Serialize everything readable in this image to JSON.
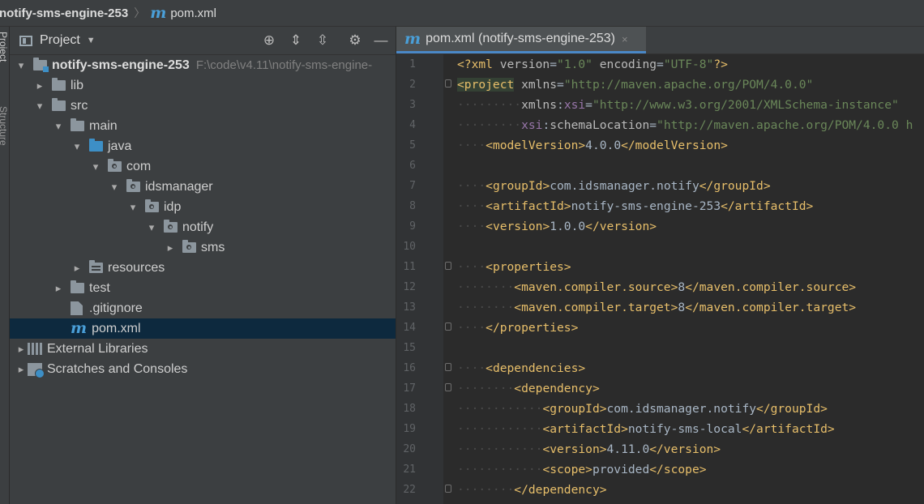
{
  "breadcrumb": {
    "project": "notify-sms-engine-253",
    "file": "pom.xml",
    "file_icon": "m"
  },
  "side_stripe": {
    "project_label": "Project",
    "structure_label": "Structure"
  },
  "project_panel": {
    "title": "Project",
    "tree": [
      {
        "label": "notify-sms-engine-253",
        "path": "F:\\code\\v4.11\\notify-sms-engine-",
        "depth": 0,
        "arrow": "down",
        "icon": "module-folder",
        "bold": true
      },
      {
        "label": "lib",
        "depth": 1,
        "arrow": "right",
        "icon": "folder"
      },
      {
        "label": "src",
        "depth": 1,
        "arrow": "down",
        "icon": "folder"
      },
      {
        "label": "main",
        "depth": 2,
        "arrow": "down",
        "icon": "folder"
      },
      {
        "label": "java",
        "depth": 3,
        "arrow": "down",
        "icon": "source-folder"
      },
      {
        "label": "com",
        "depth": 4,
        "arrow": "down",
        "icon": "package"
      },
      {
        "label": "idsmanager",
        "depth": 5,
        "arrow": "down",
        "icon": "package"
      },
      {
        "label": "idp",
        "depth": 6,
        "arrow": "down",
        "icon": "package"
      },
      {
        "label": "notify",
        "depth": 7,
        "arrow": "down",
        "icon": "package"
      },
      {
        "label": "sms",
        "depth": 8,
        "arrow": "right",
        "icon": "package"
      },
      {
        "label": "resources",
        "depth": 3,
        "arrow": "right",
        "icon": "resources-folder"
      },
      {
        "label": "test",
        "depth": 2,
        "arrow": "right",
        "icon": "folder"
      },
      {
        "label": ".gitignore",
        "depth": 2,
        "arrow": "none",
        "icon": "gitignore"
      },
      {
        "label": "pom.xml",
        "depth": 2,
        "arrow": "none",
        "icon": "maven",
        "selected": true
      },
      {
        "label": "External Libraries",
        "depth": 0,
        "arrow": "right",
        "icon": "libraries"
      },
      {
        "label": "Scratches and Consoles",
        "depth": 0,
        "arrow": "right",
        "icon": "scratches"
      }
    ]
  },
  "editor": {
    "tab_label": "pom.xml (notify-sms-engine-253)",
    "tab_close": "×",
    "lines": [
      {
        "n": "1",
        "indent": 0,
        "parts": [
          [
            "tag",
            "<?xml "
          ],
          [
            "attr",
            "version"
          ],
          [
            "pl",
            "="
          ],
          [
            "val",
            "\"1.0\""
          ],
          [
            "attr",
            " encoding"
          ],
          [
            "pl",
            "="
          ],
          [
            "val",
            "\"UTF-8\""
          ],
          [
            "tag",
            "?>"
          ]
        ]
      },
      {
        "n": "2",
        "indent": 0,
        "fold": true,
        "parts": [
          [
            "hl",
            "<project"
          ],
          [
            "attr",
            " xmlns"
          ],
          [
            "pl",
            "="
          ],
          [
            "val",
            "\"http://maven.apache.org/POM/4.0.0\""
          ]
        ]
      },
      {
        "n": "3",
        "indent": 9,
        "parts": [
          [
            "attr",
            "xmlns"
          ],
          [
            "pl",
            ":"
          ],
          [
            "ns",
            "xsi"
          ],
          [
            "pl",
            "="
          ],
          [
            "val",
            "\"http://www.w3.org/2001/XMLSchema-instance\""
          ]
        ]
      },
      {
        "n": "4",
        "indent": 9,
        "parts": [
          [
            "ns",
            "xsi"
          ],
          [
            "pl",
            ":"
          ],
          [
            "attr",
            "schemaLocation"
          ],
          [
            "pl",
            "="
          ],
          [
            "val",
            "\"http://maven.apache.org/POM/4.0.0 h"
          ]
        ]
      },
      {
        "n": "5",
        "indent": 4,
        "parts": [
          [
            "tag",
            "<modelVersion>"
          ],
          [
            "pl",
            "4.0.0"
          ],
          [
            "tag",
            "</modelVersion>"
          ]
        ]
      },
      {
        "n": "6",
        "indent": 0,
        "parts": []
      },
      {
        "n": "7",
        "indent": 4,
        "parts": [
          [
            "tag",
            "<groupId>"
          ],
          [
            "pl",
            "com.idsmanager.notify"
          ],
          [
            "tag",
            "</groupId>"
          ]
        ]
      },
      {
        "n": "8",
        "indent": 4,
        "parts": [
          [
            "tag",
            "<artifactId>"
          ],
          [
            "pl",
            "notify-sms-engine-253"
          ],
          [
            "tag",
            "</artifactId>"
          ]
        ]
      },
      {
        "n": "9",
        "indent": 4,
        "parts": [
          [
            "tag",
            "<version>"
          ],
          [
            "pl",
            "1.0.0"
          ],
          [
            "tag",
            "</version>"
          ]
        ]
      },
      {
        "n": "10",
        "indent": 0,
        "parts": []
      },
      {
        "n": "11",
        "indent": 4,
        "fold": true,
        "parts": [
          [
            "tag",
            "<properties>"
          ]
        ]
      },
      {
        "n": "12",
        "indent": 8,
        "parts": [
          [
            "tag",
            "<maven.compiler.source>"
          ],
          [
            "pl",
            "8"
          ],
          [
            "tag",
            "</maven.compiler.source>"
          ]
        ]
      },
      {
        "n": "13",
        "indent": 8,
        "parts": [
          [
            "tag",
            "<maven.compiler.target>"
          ],
          [
            "pl",
            "8"
          ],
          [
            "tag",
            "</maven.compiler.target>"
          ]
        ]
      },
      {
        "n": "14",
        "indent": 4,
        "fold": true,
        "parts": [
          [
            "tag",
            "</properties>"
          ]
        ]
      },
      {
        "n": "15",
        "indent": 0,
        "parts": []
      },
      {
        "n": "16",
        "indent": 4,
        "fold": true,
        "parts": [
          [
            "tag",
            "<dependencies>"
          ]
        ]
      },
      {
        "n": "17",
        "indent": 8,
        "fold": true,
        "parts": [
          [
            "tag",
            "<dependency>"
          ]
        ]
      },
      {
        "n": "18",
        "indent": 12,
        "parts": [
          [
            "tag",
            "<groupId>"
          ],
          [
            "pl",
            "com.idsmanager.notify"
          ],
          [
            "tag",
            "</groupId>"
          ]
        ]
      },
      {
        "n": "19",
        "indent": 12,
        "parts": [
          [
            "tag",
            "<artifactId>"
          ],
          [
            "pl",
            "notify-sms-local"
          ],
          [
            "tag",
            "</artifactId>"
          ]
        ]
      },
      {
        "n": "20",
        "indent": 12,
        "parts": [
          [
            "tag",
            "<version>"
          ],
          [
            "pl",
            "4.11.0"
          ],
          [
            "tag",
            "</version>"
          ]
        ]
      },
      {
        "n": "21",
        "indent": 12,
        "parts": [
          [
            "tag",
            "<scope>"
          ],
          [
            "pl",
            "provided"
          ],
          [
            "tag",
            "</scope>"
          ]
        ]
      },
      {
        "n": "22",
        "indent": 8,
        "fold": true,
        "parts": [
          [
            "tag",
            "</dependency>"
          ]
        ]
      }
    ]
  }
}
